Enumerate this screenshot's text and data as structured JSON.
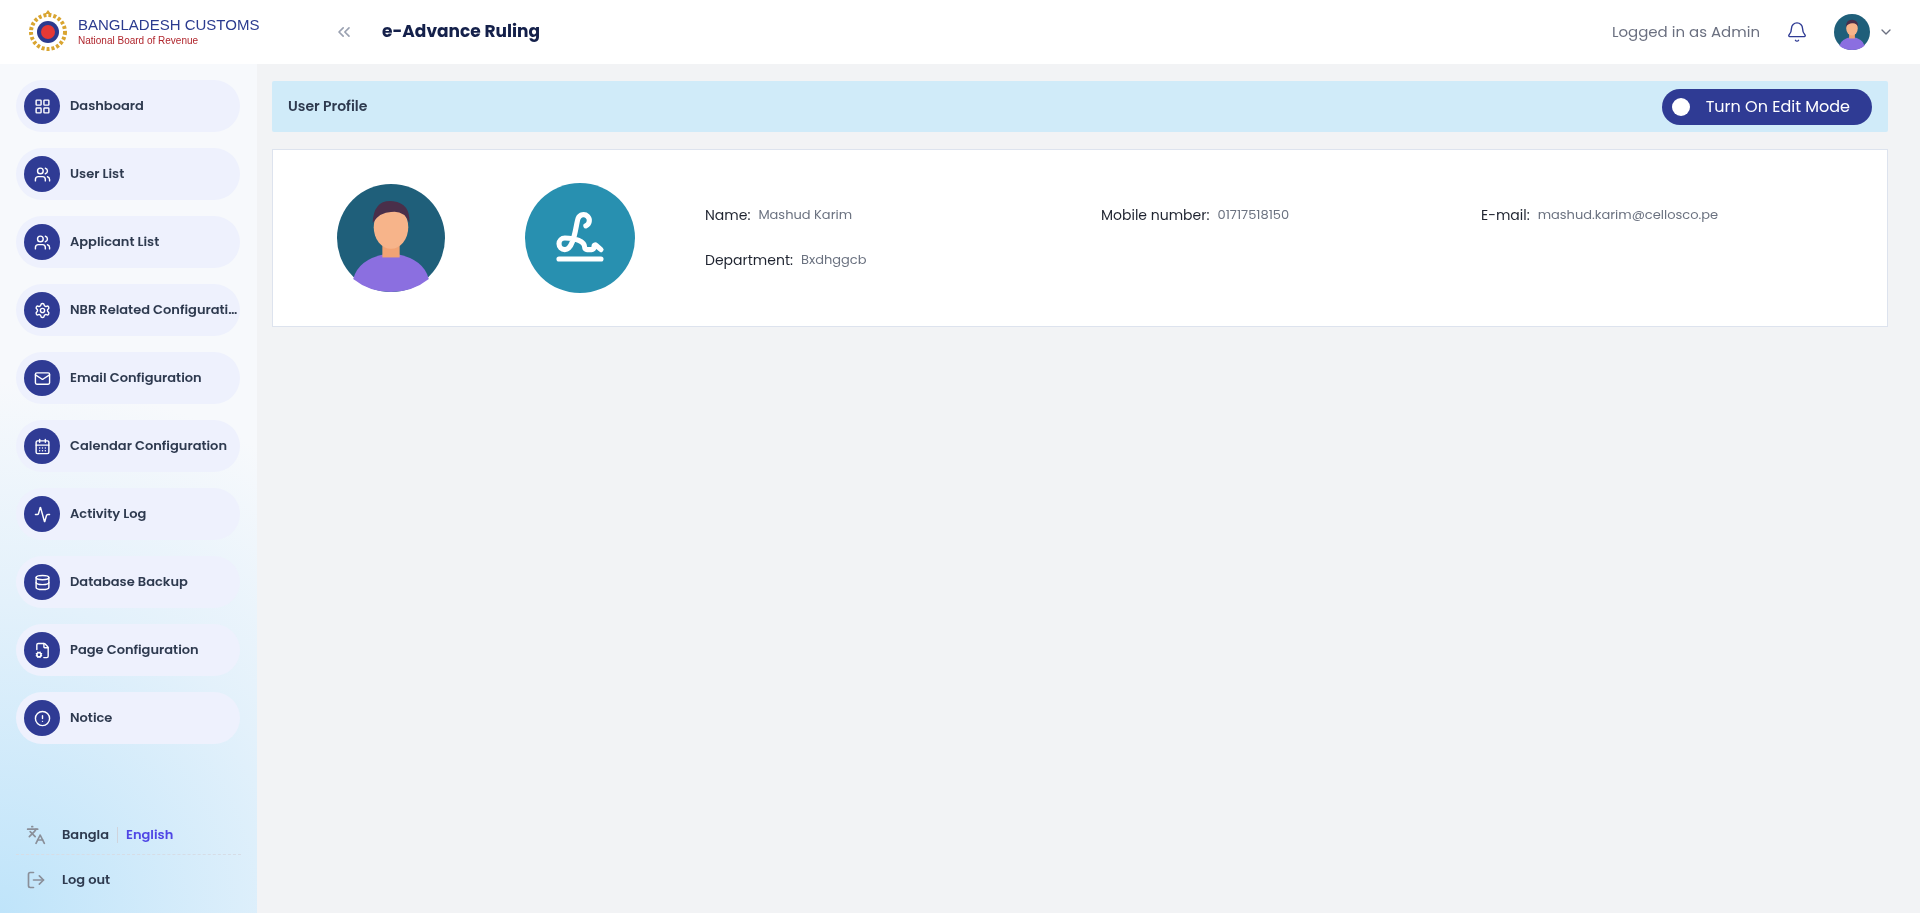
{
  "header": {
    "brand_title": "BANGLADESH CUSTOMS",
    "brand_subtitle": "National Board of Revenue",
    "app_title": "e-Advance Ruling",
    "logged_in_text": "Logged in as Admin"
  },
  "sidebar": {
    "items": [
      {
        "label": "Dashboard",
        "kind": "dashboard",
        "selected": false
      },
      {
        "label": "User List",
        "kind": "users",
        "selected": false
      },
      {
        "label": "Applicant List",
        "kind": "users",
        "selected": false
      },
      {
        "label": "NBR Related Configurati…",
        "kind": "settings",
        "selected": false
      },
      {
        "label": "Email Configuration",
        "kind": "mail",
        "selected": false
      },
      {
        "label": "Calendar Configuration",
        "kind": "calendar",
        "selected": false
      },
      {
        "label": "Activity Log",
        "kind": "activity",
        "selected": false
      },
      {
        "label": "Database Backup",
        "kind": "database",
        "selected": false
      },
      {
        "label": "Page Configuration",
        "kind": "page",
        "selected": false
      },
      {
        "label": "Notice",
        "kind": "notice",
        "selected": false
      }
    ],
    "languages": [
      {
        "label": "Bangla",
        "selected": false
      },
      {
        "label": "English",
        "selected": true
      }
    ],
    "logout": "Log out"
  },
  "profile_bar": {
    "title": "User Profile",
    "edit_toggle": {
      "label": "Turn On Edit Mode",
      "on": false
    }
  },
  "profile": {
    "fields": [
      {
        "label": "Name:",
        "value": "Mashud Karim"
      },
      {
        "label": "Mobile number:",
        "value": "01717518150"
      },
      {
        "label": "E-mail:",
        "value": "mashud.karim@cellosco.pe"
      },
      {
        "label": "Department:",
        "value": "Bxdhggcb"
      }
    ]
  }
}
